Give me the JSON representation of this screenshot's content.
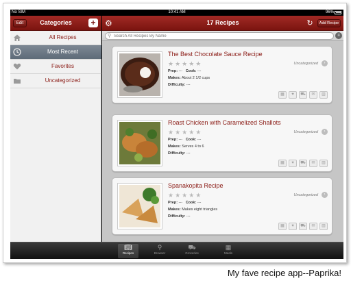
{
  "status": {
    "carrier": "No SIM",
    "time": "10:41 AM",
    "battery": "96%"
  },
  "sidebar": {
    "edit_label": "Edit",
    "title": "Categories",
    "add_label": "+",
    "items": [
      {
        "label": "All Recipes",
        "icon": "home-icon"
      },
      {
        "label": "Most Recent",
        "icon": "clock-icon"
      },
      {
        "label": "Favorites",
        "icon": "heart-icon"
      },
      {
        "label": "Uncategorized",
        "icon": "folder-icon"
      }
    ]
  },
  "header": {
    "title": "17 Recipes",
    "add_recipe_label": "Add Recipe"
  },
  "search": {
    "placeholder": "Search All Recipes By Name"
  },
  "labels": {
    "prep": "Prep:",
    "cook": "Cook:",
    "makes": "Makes:",
    "difficulty": "Difficulty:"
  },
  "recipes": [
    {
      "title": "The Best Chocolate Sauce Recipe",
      "category": "Uncategorized",
      "prep": "---",
      "cook": "---",
      "makes": "About 2 1/2 cups",
      "difficulty": "---",
      "rating": 0
    },
    {
      "title": "Roast Chicken with Caramelized Shallots",
      "category": "Uncategorized",
      "prep": "---",
      "cook": "---",
      "makes": "Serves 4 to 6",
      "difficulty": "---",
      "rating": 0
    },
    {
      "title": "Spanakopita Recipe",
      "category": "Uncategorized",
      "prep": "---",
      "cook": "---",
      "makes": "Makes eight triangles",
      "difficulty": "---",
      "rating": 0
    }
  ],
  "tabs": [
    {
      "label": "Recipes",
      "icon": "book-icon"
    },
    {
      "label": "Browser",
      "icon": "magnifier-icon"
    },
    {
      "label": "Groceries",
      "icon": "cart-icon"
    },
    {
      "label": "Meals",
      "icon": "calendar-icon"
    }
  ],
  "caption": "My fave recipe app--Paprika!",
  "colors": {
    "brand": "#8a1a14",
    "active_item": "#6a7682"
  }
}
